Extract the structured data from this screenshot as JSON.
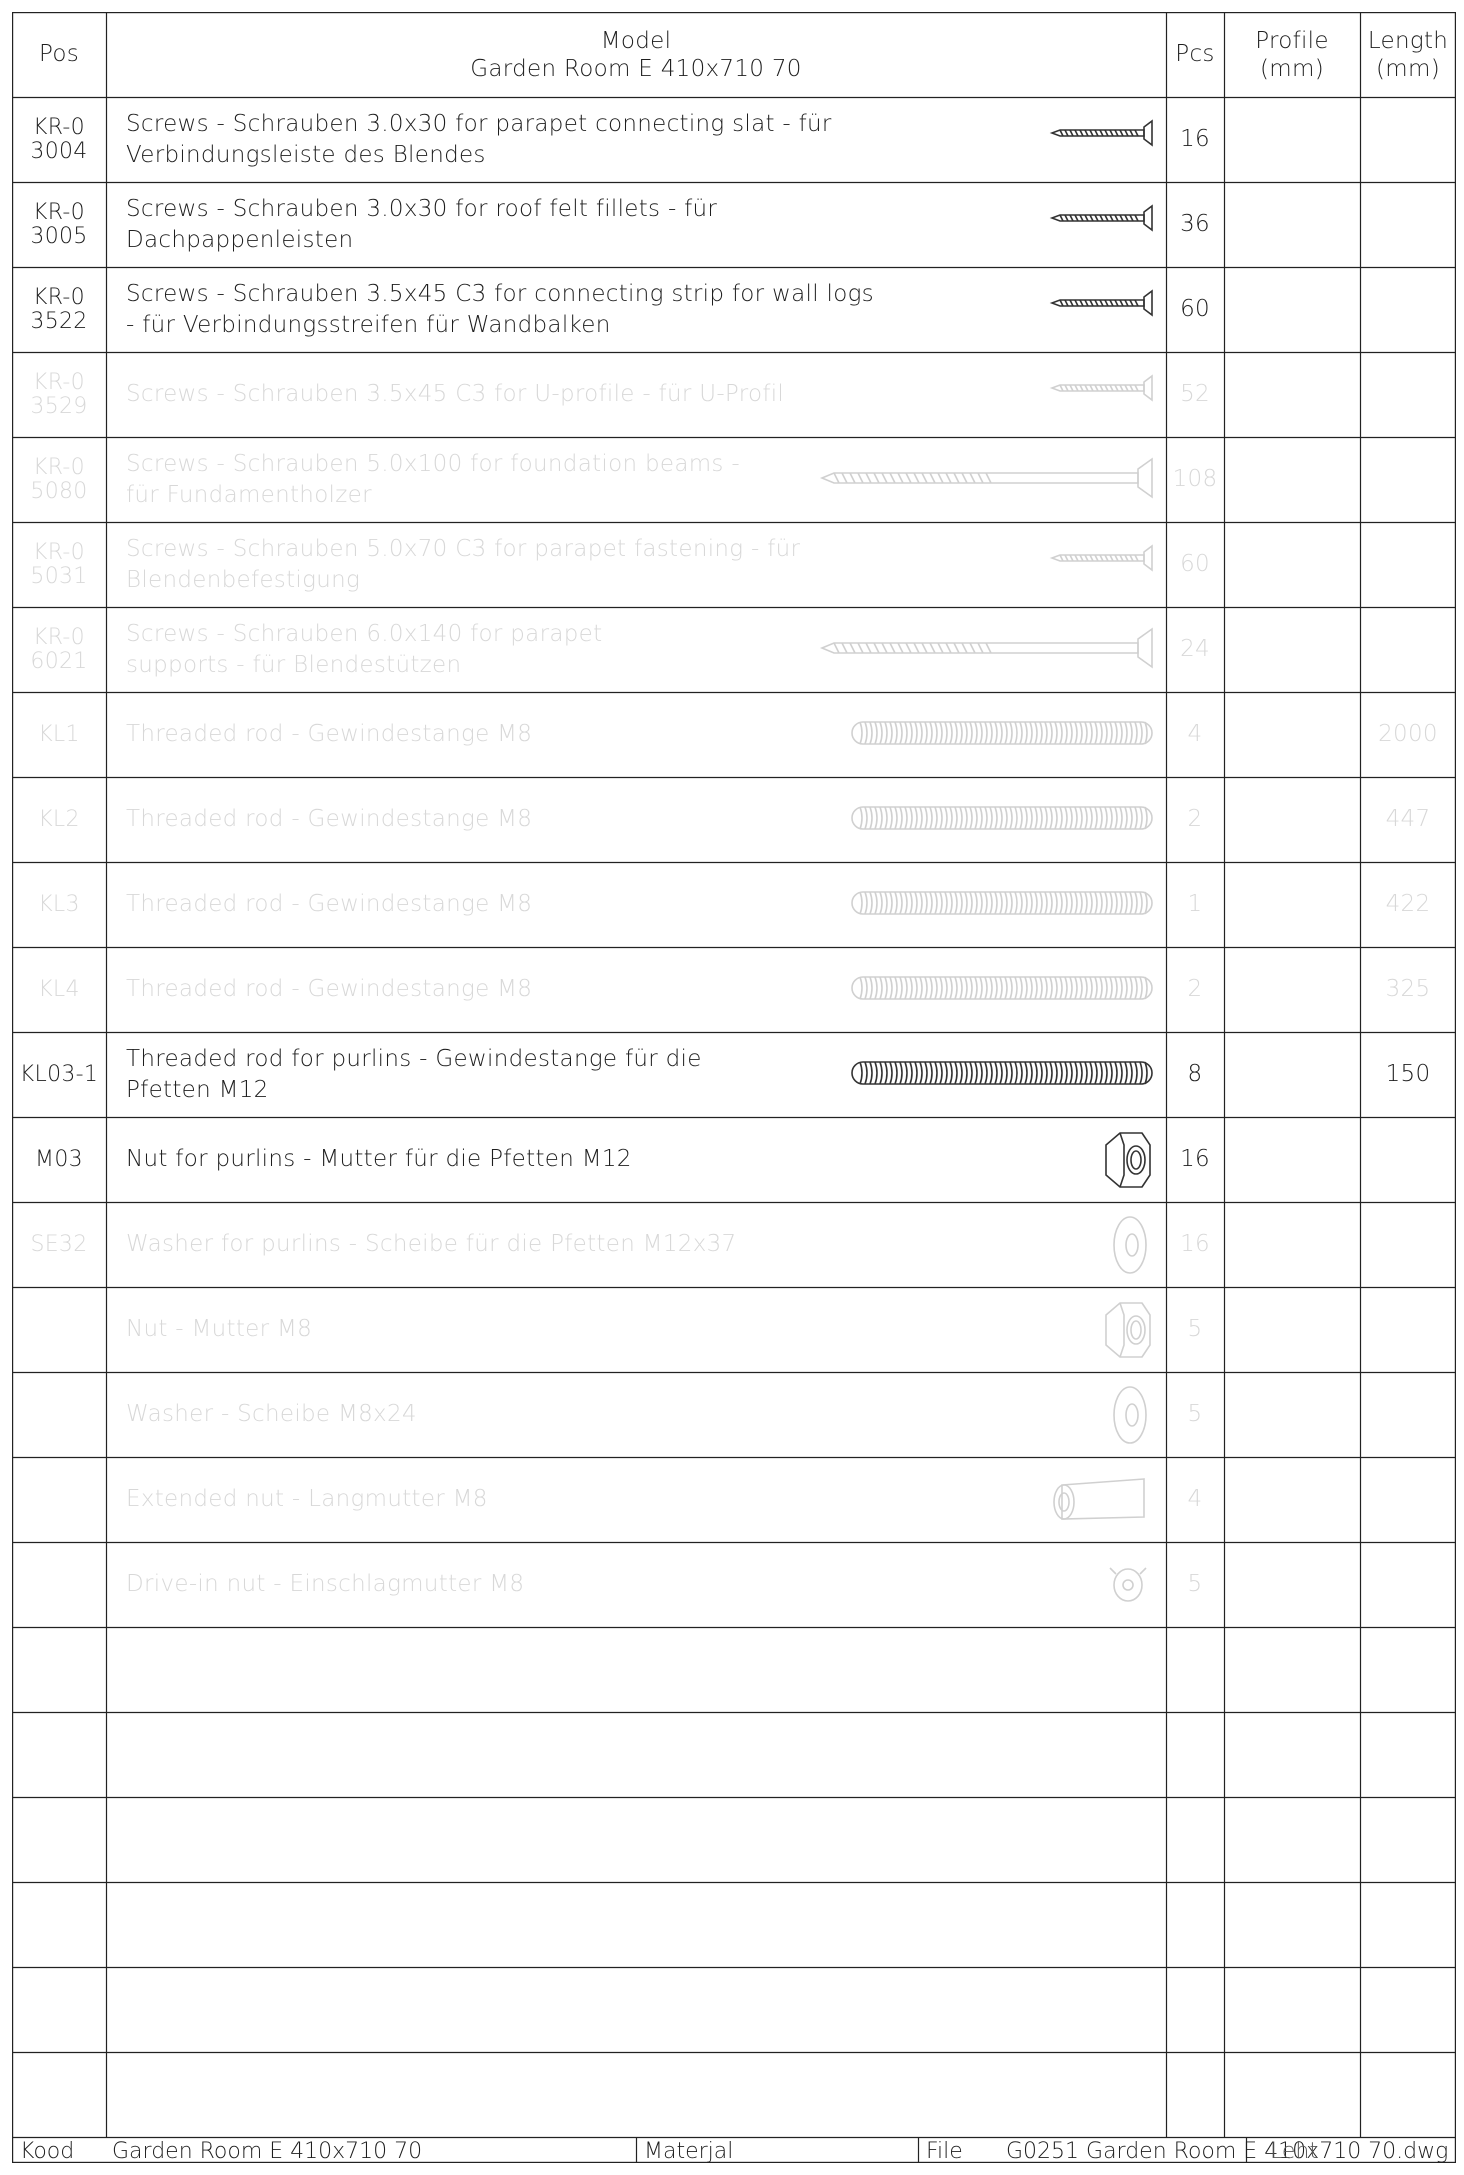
{
  "header": {
    "pos": "Pos",
    "model_line1": "Model",
    "model_line2": "Garden Room E 410x710 70",
    "pcs": "Pcs",
    "profile_line1": "Profile",
    "profile_line2": "(mm)",
    "length_line1": "Length",
    "length_line2": "(mm)"
  },
  "rows": [
    {
      "pos1": "KR-0",
      "pos2": "3004",
      "d1": "Screws - Schrauben 3.0x30   for parapet connecting slat - für",
      "d2": "Verbindungsleiste des Blendes",
      "pcs": "16",
      "length": "",
      "icon": "screw-icon",
      "faded": false
    },
    {
      "pos1": "KR-0",
      "pos2": "3005",
      "d1": "Screws - Schrauben 3.0x30   for roof felt fillets - für",
      "d2": "Dachpappenleisten",
      "pcs": "36",
      "length": "",
      "icon": "screw-icon",
      "faded": false
    },
    {
      "pos1": "KR-0",
      "pos2": "3522",
      "d1": "Screws - Schrauben 3.5x45 C3   for connecting strip for wall logs",
      "d2": "- für Verbindungsstreifen für Wandbalken",
      "pcs": "60",
      "length": "",
      "icon": "screw-icon",
      "faded": false
    },
    {
      "pos1": "KR-0",
      "pos2": "3529",
      "d1": "Screws - Schrauben 3.5x45 C3   for U-profile - für U-Profil",
      "d2": "",
      "pcs": "52",
      "length": "",
      "icon": "screw-icon",
      "faded": true
    },
    {
      "pos1": "KR-0",
      "pos2": "5080",
      "d1": "Screws - Schrauben 5.0x100   for foundation beams -",
      "d2": "für Fundamentholzer",
      "pcs": "108",
      "length": "",
      "icon": "long-screw-icon",
      "faded": true
    },
    {
      "pos1": "KR-0",
      "pos2": "5031",
      "d1": "Screws - Schrauben 5.0x70 C3   for parapet fastening - für",
      "d2": "Blendenbefestigung",
      "pcs": "60",
      "length": "",
      "icon": "screw-icon",
      "faded": true
    },
    {
      "pos1": "KR-0",
      "pos2": "6021",
      "d1": "Screws - Schrauben 6.0x140   for parapet",
      "d2": "supports - für Blendestützen",
      "pcs": "24",
      "length": "",
      "icon": "long-screw-icon",
      "faded": true
    },
    {
      "pos1": "KL1",
      "pos2": "",
      "d1": "Threaded rod - Gewindestange M8",
      "d2": "",
      "pcs": "4",
      "length": "2000",
      "icon": "threaded-rod-icon",
      "faded": true
    },
    {
      "pos1": "KL2",
      "pos2": "",
      "d1": "Threaded rod - Gewindestange M8",
      "d2": "",
      "pcs": "2",
      "length": "447",
      "icon": "threaded-rod-icon",
      "faded": true
    },
    {
      "pos1": "KL3",
      "pos2": "",
      "d1": "Threaded rod - Gewindestange M8",
      "d2": "",
      "pcs": "1",
      "length": "422",
      "icon": "threaded-rod-icon",
      "faded": true
    },
    {
      "pos1": "KL4",
      "pos2": "",
      "d1": "Threaded rod - Gewindestange M8",
      "d2": "",
      "pcs": "2",
      "length": "325",
      "icon": "threaded-rod-icon",
      "faded": true
    },
    {
      "pos1": "KL03-1",
      "pos2": "",
      "d1": "Threaded rod for purlins - Gewindestange für die",
      "d2": "Pfetten M12",
      "pcs": "8",
      "length": "150",
      "icon": "threaded-rod-icon",
      "faded": false
    },
    {
      "pos1": "M03",
      "pos2": "",
      "d1": "Nut for purlins - Mutter für die Pfetten M12",
      "d2": "",
      "pcs": "16",
      "length": "",
      "icon": "hex-nut-icon",
      "faded": false
    },
    {
      "pos1": "SE32",
      "pos2": "",
      "d1": "Washer for purlins - Scheibe für die Pfetten M12x37",
      "d2": "",
      "pcs": "16",
      "length": "",
      "icon": "washer-icon",
      "faded": true
    },
    {
      "pos1": "",
      "pos2": "",
      "d1": "Nut - Mutter M8",
      "d2": "",
      "pcs": "5",
      "length": "",
      "icon": "hex-nut-icon",
      "faded": true
    },
    {
      "pos1": "",
      "pos2": "",
      "d1": "Washer - Scheibe M8x24",
      "d2": "",
      "pcs": "5",
      "length": "",
      "icon": "washer-icon",
      "faded": true
    },
    {
      "pos1": "",
      "pos2": "",
      "d1": "Extended nut - Langmutter M8",
      "d2": "",
      "pcs": "4",
      "length": "",
      "icon": "extended-nut-icon",
      "faded": true
    },
    {
      "pos1": "",
      "pos2": "",
      "d1": "Drive-in nut - Einschlagmutter M8",
      "d2": "",
      "pcs": "5",
      "length": "",
      "icon": "drive-in-nut-icon",
      "faded": true
    }
  ],
  "footer": {
    "kood_label": "Kood",
    "kood_value": "Garden Room E 410x710 70",
    "materjal_label": "Materjal",
    "file_label": "File",
    "file_value": "G0251 Garden Room E 410x710 70.dwg",
    "file_overlay": "Leht"
  }
}
